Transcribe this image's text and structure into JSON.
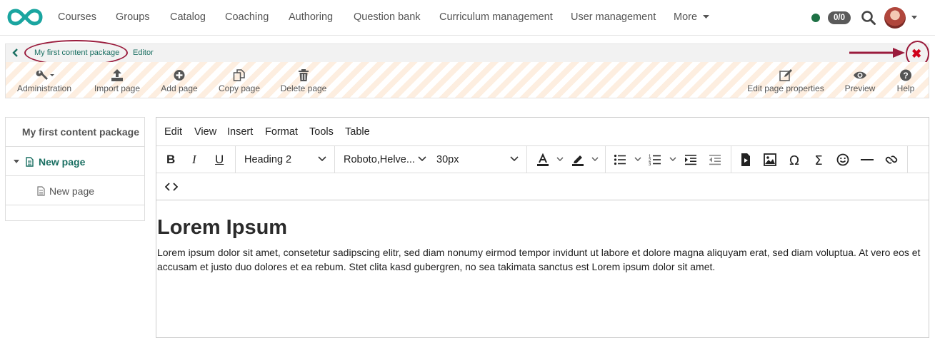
{
  "topnav": {
    "items": [
      "Courses",
      "Groups",
      "Catalog",
      "Coaching",
      "Authoring",
      "Question bank",
      "Curriculum management",
      "User management",
      "More"
    ],
    "badge_count": "0/0",
    "status_color": "#1e7145"
  },
  "breadcrumb": {
    "items": [
      "My first content package",
      "Editor"
    ]
  },
  "toolbar": {
    "left_tools": [
      {
        "label": "Administration",
        "icon": "wrench-icon"
      },
      {
        "label": "Import page",
        "icon": "upload-icon"
      },
      {
        "label": "Add page",
        "icon": "plus-circle-icon"
      },
      {
        "label": "Copy page",
        "icon": "copy-icon"
      },
      {
        "label": "Delete page",
        "icon": "trash-icon"
      }
    ],
    "right_tools": [
      {
        "label": "Edit page properties",
        "icon": "edit-icon"
      },
      {
        "label": "Preview",
        "icon": "eye-icon"
      },
      {
        "label": "Help",
        "icon": "help-icon"
      }
    ]
  },
  "tree": {
    "title": "My first content package",
    "items": [
      {
        "label": "New page",
        "level": 1,
        "expanded": true
      },
      {
        "label": "New page",
        "level": 2
      }
    ]
  },
  "editor": {
    "menu": [
      "Edit",
      "View",
      "Insert",
      "Format",
      "Tools",
      "Table"
    ],
    "block_format": "Heading 2",
    "font_family": "Roboto,Helve...",
    "font_size": "30px",
    "content": {
      "heading": "Lorem Ipsum",
      "paragraph": "Lorem ipsum dolor sit amet, consetetur sadipscing elitr, sed diam nonumy eirmod tempor invidunt ut labore et dolore magna aliquyam erat, sed diam voluptua. At vero eos et accusam et justo duo dolores et ea rebum. Stet clita kasd gubergren, no sea takimata sanctus est Lorem ipsum dolor sit amet."
    }
  },
  "colors": {
    "accent": "#1a6f62",
    "annotation": "#9a1b3c",
    "close": "#d0021b",
    "stripe": "#fdeee0"
  }
}
